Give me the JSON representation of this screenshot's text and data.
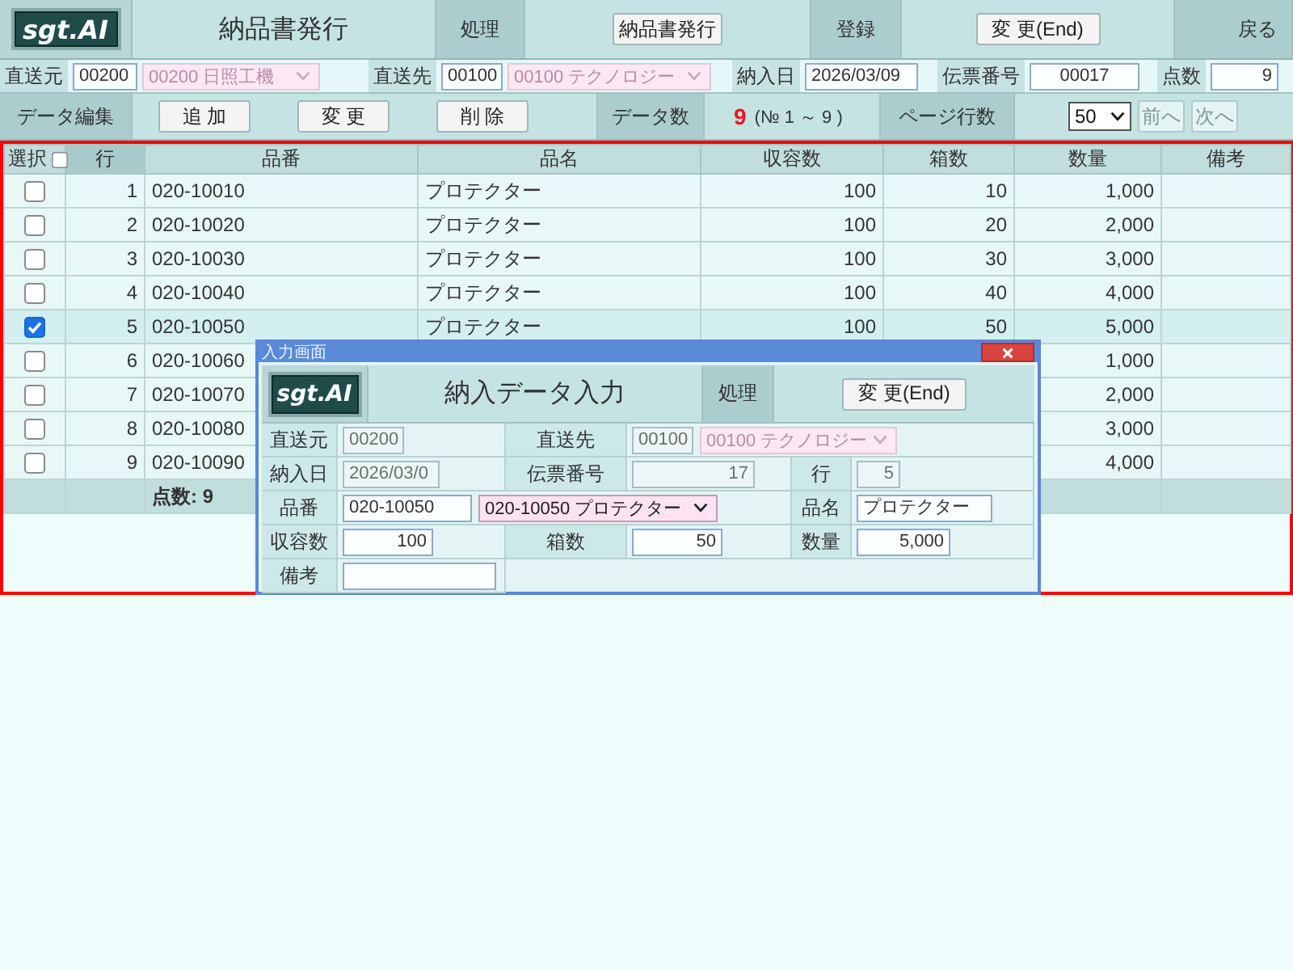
{
  "header": {
    "logo": "sgt.AI",
    "title": "納品書発行",
    "actions": [
      {
        "label": "処理",
        "button": "納品書発行"
      },
      {
        "label": "登録",
        "button": "変 更(End)"
      }
    ],
    "back": "戻る"
  },
  "filter_bar": [
    {
      "label": "直送元",
      "inputs": [
        {
          "kind": "code",
          "value": "00200",
          "disabled": false
        },
        {
          "kind": "select",
          "value": "00200 日照工機",
          "disabled": true
        }
      ]
    },
    {
      "label": "直送先",
      "inputs": [
        {
          "kind": "code",
          "value": "00100",
          "disabled": false
        },
        {
          "kind": "select",
          "value": "00100 テクノロジー",
          "disabled": true
        }
      ]
    },
    {
      "label": "納入日",
      "inputs": [
        {
          "kind": "date",
          "value": "2026/03/09",
          "disabled": false
        }
      ]
    },
    {
      "label": "伝票番号",
      "inputs": [
        {
          "kind": "slip",
          "value": "00017",
          "disabled": false
        }
      ]
    },
    {
      "label": "点数",
      "inputs": [
        {
          "kind": "number",
          "value": "9",
          "disabled": false
        }
      ]
    }
  ],
  "edit_bar": {
    "label": "データ編集",
    "buttons": [
      "追 加",
      "変 更",
      "削 除"
    ],
    "count_label": "データ数",
    "count": "9",
    "range": "(№ 1 ～ 9 )",
    "page_rows_label": "ページ行数",
    "page_rows": "50",
    "nav": [
      {
        "label": "前へ",
        "disabled": true
      },
      {
        "label": "次へ",
        "disabled": true
      }
    ]
  },
  "table": {
    "columns": [
      "選択",
      "行",
      "品番",
      "品名",
      "収容数",
      "箱数",
      "数量",
      "備考"
    ],
    "select_all": false,
    "rows": [
      {
        "checked": false,
        "row": "1",
        "part_no": "020-10010",
        "name": "プロテクター",
        "capacity": "100",
        "boxes": "10",
        "quantity": "1,000"
      },
      {
        "checked": false,
        "row": "2",
        "part_no": "020-10020",
        "name": "プロテクター",
        "capacity": "100",
        "boxes": "20",
        "quantity": "2,000"
      },
      {
        "checked": false,
        "row": "3",
        "part_no": "020-10030",
        "name": "プロテクター",
        "capacity": "100",
        "boxes": "30",
        "quantity": "3,000"
      },
      {
        "checked": false,
        "row": "4",
        "part_no": "020-10040",
        "name": "プロテクター",
        "capacity": "100",
        "boxes": "40",
        "quantity": "4,000"
      },
      {
        "checked": true,
        "row": "5",
        "part_no": "020-10050",
        "name": "プロテクター",
        "capacity": "100",
        "boxes": "50",
        "quantity": "5,000"
      },
      {
        "checked": false,
        "row": "6",
        "part_no": "020-10060",
        "quantity": "1,000"
      },
      {
        "checked": false,
        "row": "7",
        "part_no": "020-10070",
        "quantity": "2,000"
      },
      {
        "checked": false,
        "row": "8",
        "part_no": "020-10080",
        "quantity": "3,000"
      },
      {
        "checked": false,
        "row": "9",
        "part_no": "020-10090",
        "quantity": "4,000"
      }
    ],
    "total": "点数: 9"
  },
  "dialog": {
    "window_title": "入力画面",
    "logo": "sgt.AI",
    "title": "納入データ入力",
    "action_label": "処理",
    "action_button": "変 更(End)",
    "rows": [
      {
        "fields": [
          {
            "label": "直送元",
            "inputs": [
              {
                "kind": "code",
                "value": "00200",
                "disabled": true
              }
            ]
          },
          {
            "label": "直送先",
            "inputs": [
              {
                "kind": "code",
                "value": "00100",
                "disabled": true
              },
              {
                "kind": "select",
                "value": "00100 テクノロジー",
                "disabled": true
              }
            ]
          }
        ]
      },
      {
        "fields": [
          {
            "label": "納入日",
            "inputs": [
              {
                "kind": "date",
                "value": "2026/03/0",
                "disabled": true
              }
            ]
          },
          {
            "label": "伝票番号",
            "inputs": [
              {
                "kind": "number",
                "value": "17",
                "disabled": true
              }
            ]
          },
          {
            "label": "行",
            "inputs": [
              {
                "kind": "number",
                "value": "5",
                "disabled": true
              }
            ]
          }
        ]
      },
      {
        "fields": [
          {
            "label": "品番",
            "inputs": [
              {
                "kind": "text",
                "value": "020-10050",
                "disabled": false
              },
              {
                "kind": "select",
                "value": "020-10050 プロテクター",
                "disabled": false
              }
            ]
          },
          {
            "label": "品名",
            "inputs": [
              {
                "kind": "text",
                "value": "プロテクター",
                "disabled": false
              }
            ]
          }
        ]
      },
      {
        "fields": [
          {
            "label": "収容数",
            "inputs": [
              {
                "kind": "number",
                "value": "100",
                "disabled": false
              }
            ]
          },
          {
            "label": "箱数",
            "inputs": [
              {
                "kind": "number",
                "value": "50",
                "disabled": false
              }
            ]
          },
          {
            "label": "数量",
            "inputs": [
              {
                "kind": "number",
                "value": "5,000",
                "disabled": false
              }
            ]
          }
        ]
      },
      {
        "fields": [
          {
            "label": "備考",
            "inputs": [
              {
                "kind": "text",
                "disabled": false
              }
            ]
          }
        ]
      }
    ]
  }
}
